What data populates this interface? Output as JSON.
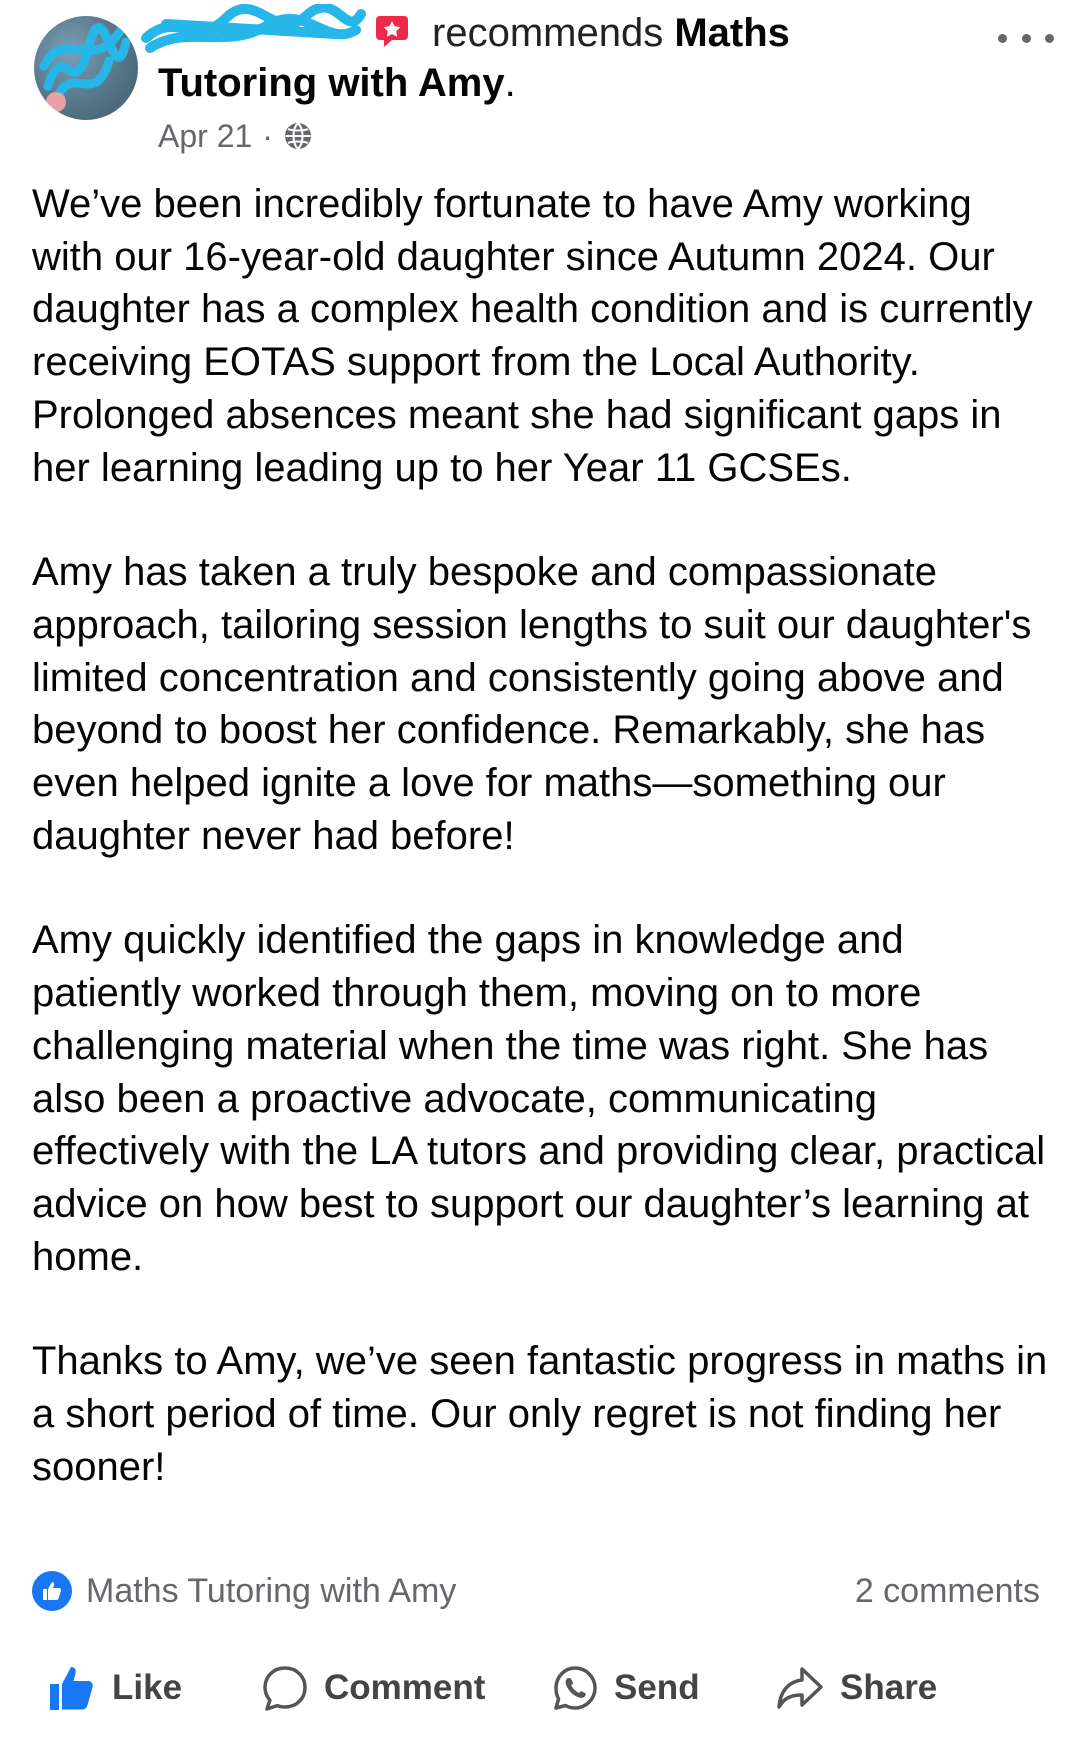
{
  "post": {
    "author_redacted": "",
    "action_text": "recommends",
    "page_name_part1": "Maths",
    "page_name_part2": "Tutoring with Amy",
    "title_suffix": ".",
    "date": "Apr 21",
    "separator": "·",
    "privacy_icon": "globe-icon",
    "more_icon": "more-options-icon"
  },
  "body": {
    "paragraphs": [
      "We’ve been incredibly fortunate to have Amy working with our 16-year-old daughter since Autumn 2024. Our daughter has a complex health condition and is currently receiving EOTAS support from the Local Authority. Prolonged absences meant she had significant gaps in her learning leading up to her Year 11 GCSEs.",
      "Amy has taken a truly bespoke and compassionate approach, tailoring session lengths to suit our daughter's limited concentration and consistently going above and beyond to boost her confidence. Remarkably, she has even helped ignite a love for maths—something our daughter never had before!",
      "Amy quickly identified the gaps in knowledge and patiently worked through them, moving on to more challenging material when the time was right. She has also been a proactive advocate, communicating effectively with the LA tutors and providing clear, practical advice on how best to support our daughter’s learning at home.",
      "Thanks to Amy, we’ve seen fantastic progress in maths in a short period of time. Our only regret is not finding her sooner!"
    ]
  },
  "reactions": {
    "reactor": "Maths Tutoring with Amy",
    "comments": "2 comments",
    "icon": "like-reaction-icon"
  },
  "actions": {
    "like": "Like",
    "comment": "Comment",
    "send": "Send",
    "share": "Share"
  },
  "colors": {
    "accent": "#1877f2",
    "secondary_text": "#65676b",
    "redaction": "#27b6e8"
  }
}
